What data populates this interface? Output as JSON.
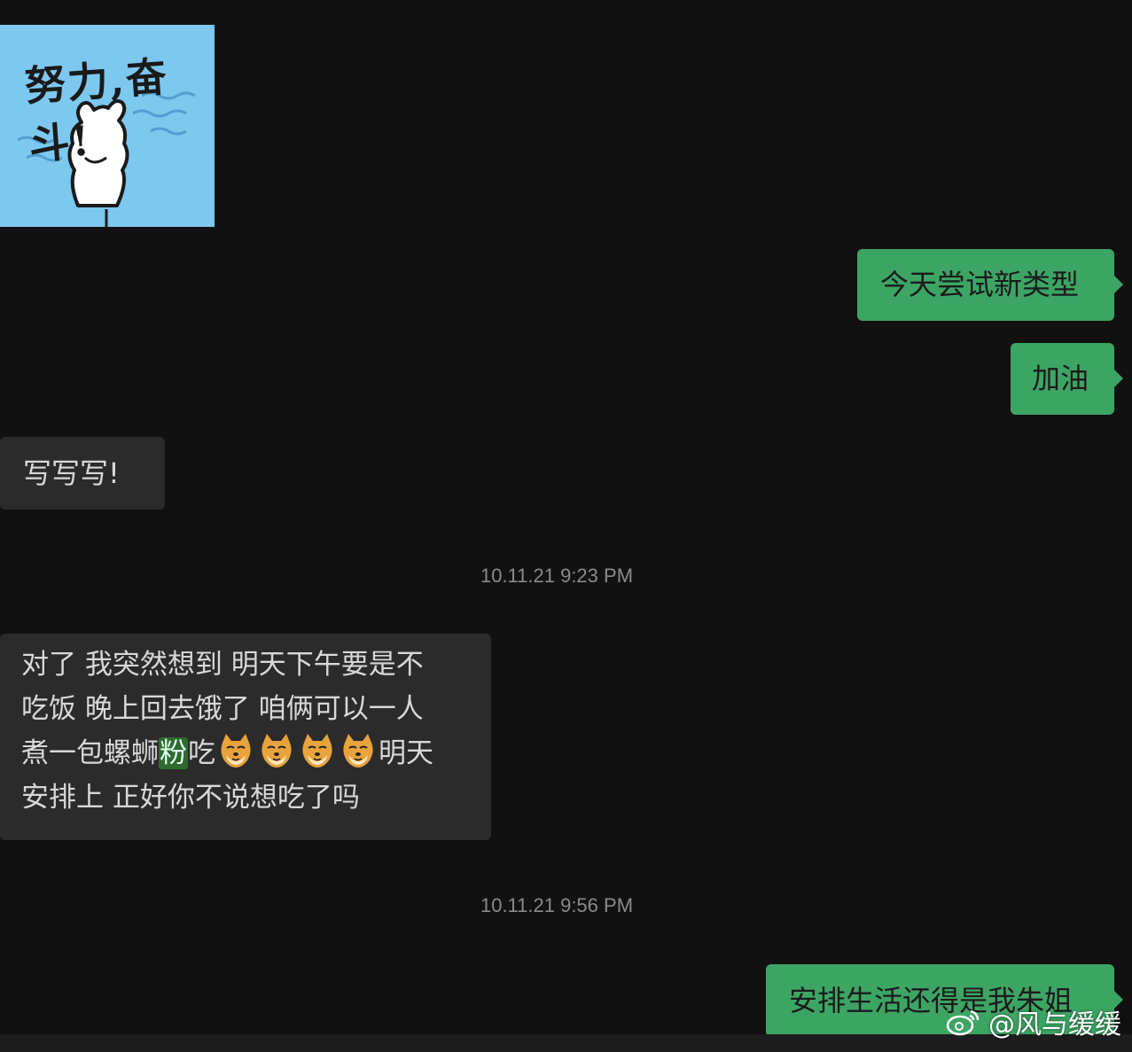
{
  "sticker": {
    "caption": "努力,奋斗!",
    "bg_color": "#7cc8ef"
  },
  "messages": [
    {
      "id": "m1",
      "side": "out",
      "text": "今天尝试新类型"
    },
    {
      "id": "m2",
      "side": "out",
      "text": "加油"
    },
    {
      "id": "m3",
      "side": "in",
      "text": "写写写!"
    }
  ],
  "timestamps": [
    "10.11.21 9:23 PM",
    "10.11.21 9:56 PM"
  ],
  "long_message": {
    "line1": "对了 我突然想到 明天下午要是不",
    "line2": "吃饭 晚上回去饿了 咱俩可以一人",
    "line3_pre": "煮一包螺蛳",
    "line3_hl": "粉",
    "line3_mid": "吃",
    "line3_post": "明天",
    "line4": "安排上 正好你不说想吃了吗",
    "emoji_name": "doge-face-icon",
    "emoji_count": 4
  },
  "last_message": "安排生活还得是我朱姐",
  "watermark": "@风与缓缓",
  "colors": {
    "background": "#111111",
    "out_bubble": "#3ca564",
    "in_bubble": "#2b2b2b",
    "timestamp": "#8a8a8a"
  }
}
